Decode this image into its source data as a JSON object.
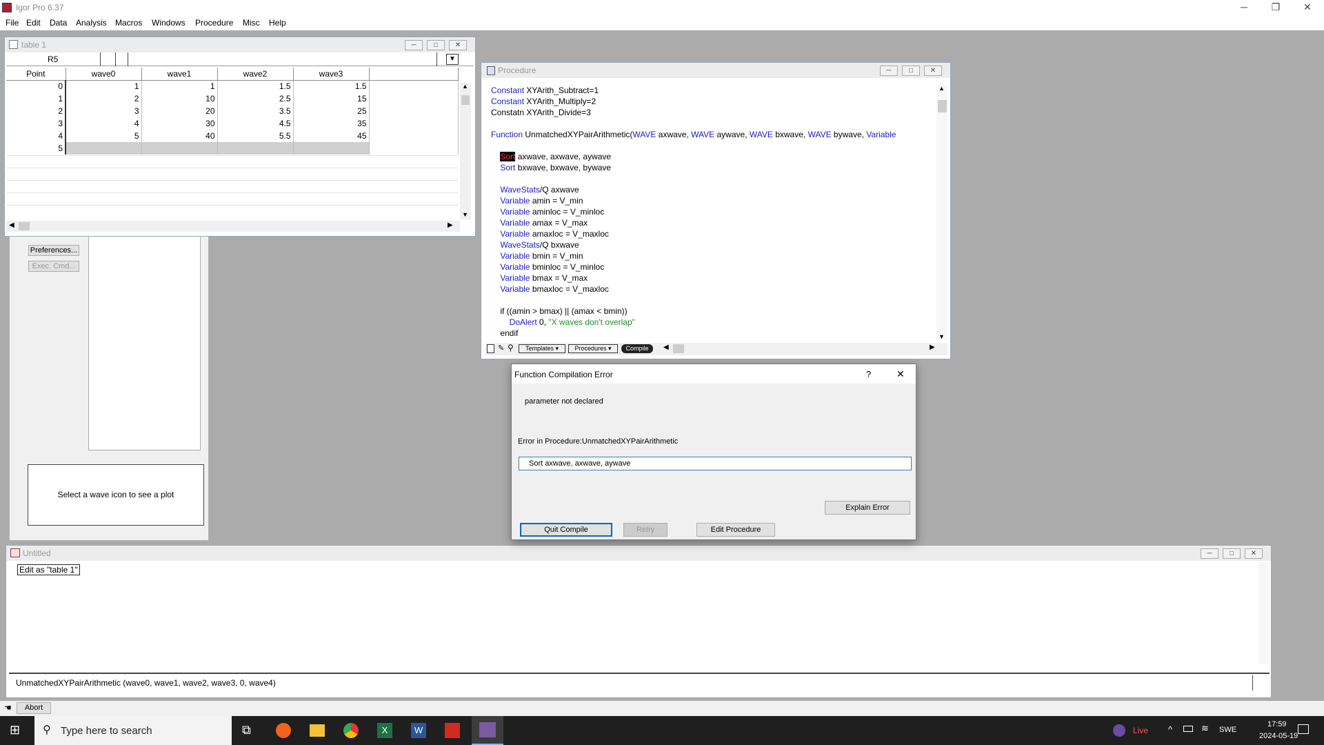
{
  "app": {
    "title": "Igor Pro 6.37",
    "menus": [
      "File",
      "Edit",
      "Data",
      "Analysis",
      "Macros",
      "Windows",
      "Procedure",
      "Misc",
      "Help"
    ]
  },
  "table_window": {
    "title": "table 1",
    "cell_ref": "R5",
    "columns": [
      "Point",
      "wave0",
      "wave1",
      "wave2",
      "wave3"
    ],
    "rows": [
      [
        "0",
        "1",
        "1",
        "1.5",
        "1.5"
      ],
      [
        "1",
        "2",
        "10",
        "2.5",
        "15"
      ],
      [
        "2",
        "3",
        "20",
        "3.5",
        "25"
      ],
      [
        "3",
        "4",
        "30",
        "4.5",
        "35"
      ],
      [
        "4",
        "5",
        "40",
        "5.5",
        "45"
      ],
      [
        "5",
        "",
        "",
        "",
        ""
      ]
    ]
  },
  "data_browser": {
    "preferences_label": "Preferences...",
    "exec_cmd_label": "Exec. Cmd...",
    "plot_hint": "Select a wave icon to see a plot"
  },
  "procedure_window": {
    "title": "Procedure",
    "templates_label": "Templates",
    "procedures_label": "Procedures",
    "compile_label": "Compile"
  },
  "error_dialog": {
    "title": "Function Compilation Error",
    "message": "parameter not declared",
    "location": "Error in Procedure:UnmatchedXYPairArithmetic",
    "code_line": "Sort axwave, axwave, aywave",
    "explain_label": "Explain Error",
    "quit_label": "Quit Compile",
    "retry_label": "Retry",
    "edit_label": "Edit Procedure",
    "help_glyph": "?",
    "close_glyph": "✕"
  },
  "command_window": {
    "title": "Untitled",
    "history_line": "Edit as \"table 1\"",
    "command_line": "UnmatchedXYPairArithmetic (wave0, wave1, wave2, wave3, 0, wave4)"
  },
  "statusbar": {
    "abort_label": "Abort"
  },
  "taskbar": {
    "search_placeholder": "Type here to search",
    "live_label": "Live",
    "lang": "SWE",
    "time": "17:59",
    "date": "2024-05-19"
  }
}
